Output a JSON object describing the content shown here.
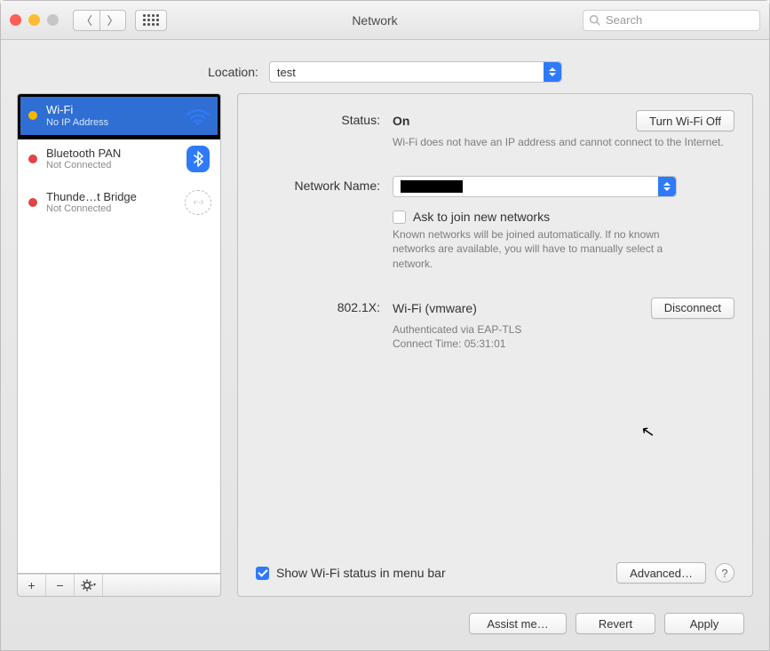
{
  "window": {
    "title": "Network"
  },
  "search": {
    "placeholder": "Search"
  },
  "location": {
    "label": "Location:",
    "value": "test"
  },
  "sidebar": {
    "items": [
      {
        "name": "Wi-Fi",
        "status": "No IP Address"
      },
      {
        "name": "Bluetooth PAN",
        "status": "Not Connected"
      },
      {
        "name": "Thunde…t Bridge",
        "status": "Not Connected"
      }
    ],
    "add": "+",
    "remove": "−",
    "gear": "✻▾"
  },
  "detail": {
    "status_label": "Status:",
    "status_value": "On",
    "wifi_toggle": "Turn Wi-Fi Off",
    "status_hint": "Wi-Fi does not have an IP address and cannot connect to the Internet.",
    "network_name_label": "Network Name:",
    "ask_join_label": "Ask to join new networks",
    "ask_join_hint": "Known networks will be joined automatically. If no known networks are available, you will have to manually select a network.",
    "dot1x_label": "802.1X:",
    "dot1x_profile": "Wi-Fi (vmware)",
    "disconnect": "Disconnect",
    "dot1x_auth": "Authenticated via EAP-TLS",
    "dot1x_time": "Connect Time: 05:31:01",
    "show_status_label": "Show Wi-Fi status in menu bar",
    "advanced": "Advanced…",
    "help": "?"
  },
  "footer": {
    "assist": "Assist me…",
    "revert": "Revert",
    "apply": "Apply"
  }
}
